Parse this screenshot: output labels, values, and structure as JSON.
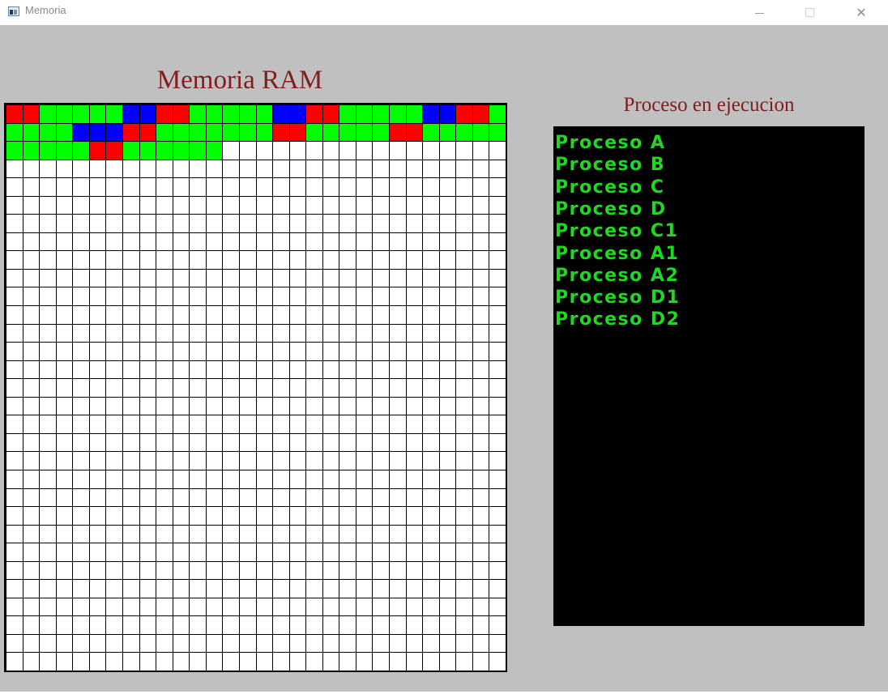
{
  "window": {
    "title": "Memoria",
    "controls": {
      "minimize_icon": "minimize-icon",
      "maximize_icon": "maximize-icon",
      "close_icon": "close-icon",
      "close_glyph": "✕"
    }
  },
  "ram": {
    "title": "Memoria RAM",
    "columns": 30,
    "rows": 31,
    "colors": {
      "G": "#00ff00",
      "R": "#ff0000",
      "B": "#0000ff",
      "W": "#ffffff"
    },
    "occupied_rows": [
      "RRGGGGGBBRRGGGGGBBRRGGGGGBBRRG",
      "GGGGBBBRRGGGGGGGRRGGGGGRRGGGGG",
      "GGGGGRRGGGGGG"
    ]
  },
  "process_panel": {
    "title": "Proceso en ejecucion",
    "processes": [
      "Proceso A",
      "Proceso B",
      "Proceso C",
      "Proceso D",
      "Proceso C1",
      "Proceso A1",
      "Proceso A2",
      "Proceso D1",
      "Proceso D2"
    ]
  }
}
